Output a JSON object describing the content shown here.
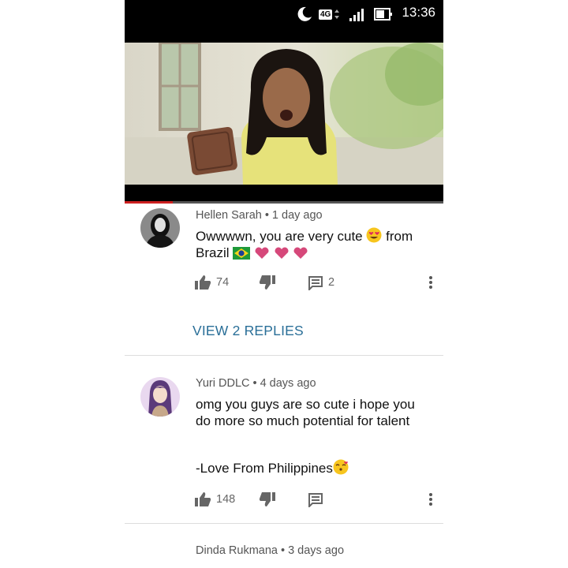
{
  "status_bar": {
    "network": "4G",
    "time": "13:36",
    "icons": [
      "moon-icon",
      "network-4g-icon",
      "signal-icon",
      "battery-icon"
    ]
  },
  "video": {
    "progress": 0.15
  },
  "comments": [
    {
      "author": "Hellen Sarah",
      "age": "1 day ago",
      "text_part1": "Owwwwn, you are very cute",
      "text_part2": "from",
      "text_line2": "Brazil",
      "likes": "74",
      "reply_count": "2",
      "view_replies": "VIEW 2 REPLIES",
      "emojis": [
        "heart-eyes-emoji",
        "brazil-flag-emoji",
        "pink-heart-emoji",
        "pink-heart-emoji",
        "pink-heart-emoji"
      ]
    },
    {
      "author": "Yuri DDLC",
      "age": "4 days ago",
      "text_line1": "omg you guys are so cute i hope you",
      "text_line2": "do more so much potential for talent",
      "text_line3": "-Love From Philippines",
      "likes": "148",
      "emojis": [
        "kissing-emoji"
      ]
    },
    {
      "author": "Dinda Rukmana",
      "age": "3 days ago"
    }
  ],
  "colors": {
    "link": "#2a6f98",
    "status_bar": "#000000",
    "progress": "#cc2020"
  }
}
